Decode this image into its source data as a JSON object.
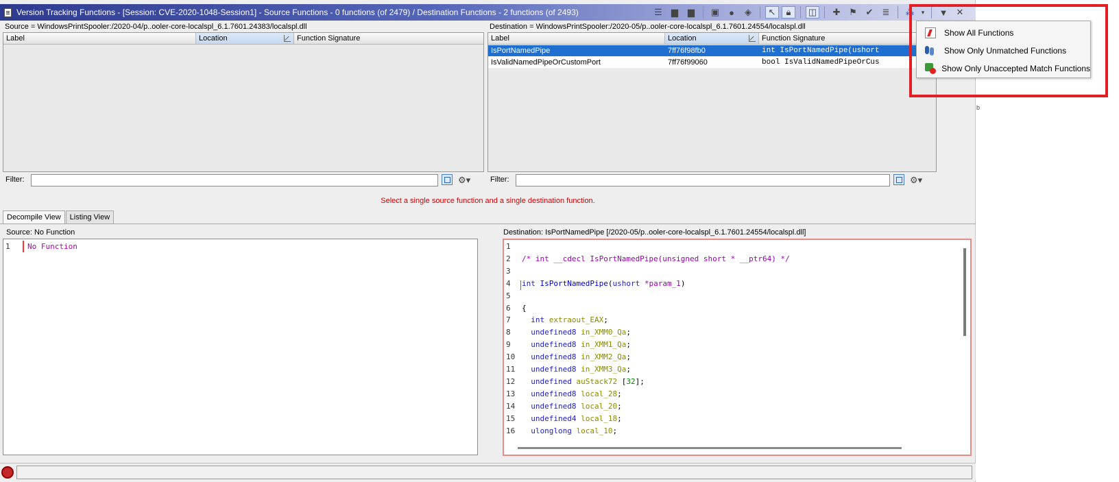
{
  "window": {
    "title": "Version Tracking Functions - [Session: CVE-2020-1048-Session1] - Source Functions - 0 functions (of 2479) / Destination Functions - 2 functions (of 2493)"
  },
  "toolbar": {
    "icons": [
      "list-icon",
      "chevron-down-icon",
      "export-icon",
      "export-alt-icon",
      "accept-icon",
      "circle-icon",
      "diamond-icon",
      "select-mode-icon",
      "lock-icon",
      "split-view-icon",
      "add-icon",
      "flag-icon",
      "checkmark-icon",
      "list-lines-icon",
      "footprints-filter-icon",
      "chevron-down-icon",
      "dropdown-arrow-icon",
      "close-icon"
    ]
  },
  "source": {
    "path": "Source = WindowsPrintSpooler:/2020-04/p..ooler-core-localspl_6.1.7601.24383/localspl.dll",
    "columns": [
      "Label",
      "Location",
      "Function Signature"
    ],
    "rows": [],
    "filter_label": "Filter:"
  },
  "destination": {
    "path": "Destination = WindowsPrintSpooler:/2020-05/p..ooler-core-localspl_6.1.7601.24554/localspl.dll",
    "columns": [
      "Label",
      "Location",
      "Function Signature"
    ],
    "rows": [
      {
        "label": "IsPortNamedPipe",
        "location": "7ff76f98fb0",
        "signature": "int IsPortNamedPipe(ushort"
      },
      {
        "label": "IsValidNamedPipeOrCustomPort",
        "location": "7ff76f99060",
        "signature": "bool IsValidNamedPipeOrCus"
      }
    ],
    "filter_label": "Filter:"
  },
  "status_message": "Select a single source function and a single destination function.",
  "tabs": [
    {
      "label": "Decompile View",
      "active": true
    },
    {
      "label": "Listing View",
      "active": false
    }
  ],
  "source_view": {
    "header": "Source: No Function",
    "line_no": "1",
    "text": "No Function"
  },
  "dest_view": {
    "header": "Destination: IsPortNamedPipe  [/2020-05/p..ooler-core-localspl_6.1.7601.24554/localspl.dll]",
    "lines": [
      {
        "n": "1",
        "tokens": []
      },
      {
        "n": "2",
        "tokens": [
          {
            "t": "/* int __cdecl IsPortNamedPipe(unsigned short * __ptr64) */",
            "c": "c"
          }
        ]
      },
      {
        "n": "3",
        "tokens": []
      },
      {
        "n": "4",
        "tokens": [
          {
            "t": "int ",
            "c": "k"
          },
          {
            "t": "IsPortNamedPipe",
            "c": "f"
          },
          {
            "t": "(",
            "c": "p"
          },
          {
            "t": "ushort ",
            "c": "k"
          },
          {
            "t": "*param_1",
            "c": "c"
          },
          {
            "t": ")",
            "c": "p"
          }
        ]
      },
      {
        "n": "5",
        "tokens": []
      },
      {
        "n": "6",
        "tokens": [
          {
            "t": "{",
            "c": "p"
          }
        ]
      },
      {
        "n": "7",
        "tokens": [
          {
            "t": "  int ",
            "c": "k"
          },
          {
            "t": "extraout_EAX",
            "c": "v"
          },
          {
            "t": ";",
            "c": "p"
          }
        ]
      },
      {
        "n": "8",
        "tokens": [
          {
            "t": "  undefined8 ",
            "c": "k"
          },
          {
            "t": "in_XMM0_Qa",
            "c": "v"
          },
          {
            "t": ";",
            "c": "p"
          }
        ]
      },
      {
        "n": "9",
        "tokens": [
          {
            "t": "  undefined8 ",
            "c": "k"
          },
          {
            "t": "in_XMM1_Qa",
            "c": "v"
          },
          {
            "t": ";",
            "c": "p"
          }
        ]
      },
      {
        "n": "10",
        "tokens": [
          {
            "t": "  undefined8 ",
            "c": "k"
          },
          {
            "t": "in_XMM2_Qa",
            "c": "v"
          },
          {
            "t": ";",
            "c": "p"
          }
        ]
      },
      {
        "n": "11",
        "tokens": [
          {
            "t": "  undefined8 ",
            "c": "k"
          },
          {
            "t": "in_XMM3_Qa",
            "c": "v"
          },
          {
            "t": ";",
            "c": "p"
          }
        ]
      },
      {
        "n": "12",
        "tokens": [
          {
            "t": "  undefined ",
            "c": "k"
          },
          {
            "t": "auStack72 ",
            "c": "v"
          },
          {
            "t": "[",
            "c": "p"
          },
          {
            "t": "32",
            "c": "n"
          },
          {
            "t": "];",
            "c": "p"
          }
        ]
      },
      {
        "n": "13",
        "tokens": [
          {
            "t": "  undefined8 ",
            "c": "k"
          },
          {
            "t": "local_28",
            "c": "v"
          },
          {
            "t": ";",
            "c": "p"
          }
        ]
      },
      {
        "n": "14",
        "tokens": [
          {
            "t": "  undefined8 ",
            "c": "k"
          },
          {
            "t": "local_20",
            "c": "v"
          },
          {
            "t": ";",
            "c": "p"
          }
        ]
      },
      {
        "n": "15",
        "tokens": [
          {
            "t": "  undefined4 ",
            "c": "k"
          },
          {
            "t": "local_18",
            "c": "v"
          },
          {
            "t": ";",
            "c": "p"
          }
        ]
      },
      {
        "n": "16",
        "tokens": [
          {
            "t": "  ulonglong ",
            "c": "k"
          },
          {
            "t": "local_10",
            "c": "v"
          },
          {
            "t": ";",
            "c": "p"
          }
        ]
      }
    ]
  },
  "popup_menu": {
    "items": [
      {
        "label": "Show All Functions",
        "icon": "show-all-icon"
      },
      {
        "label": "Show Only Unmatched Functions",
        "icon": "unmatched-footprints-icon"
      },
      {
        "label": "Show Only Unaccepted Match Functions",
        "icon": "unaccepted-match-icon"
      }
    ]
  },
  "colors": {
    "highlight": "#e31e24",
    "selection": "#1f6fd0",
    "status_message": "#cc0000"
  }
}
